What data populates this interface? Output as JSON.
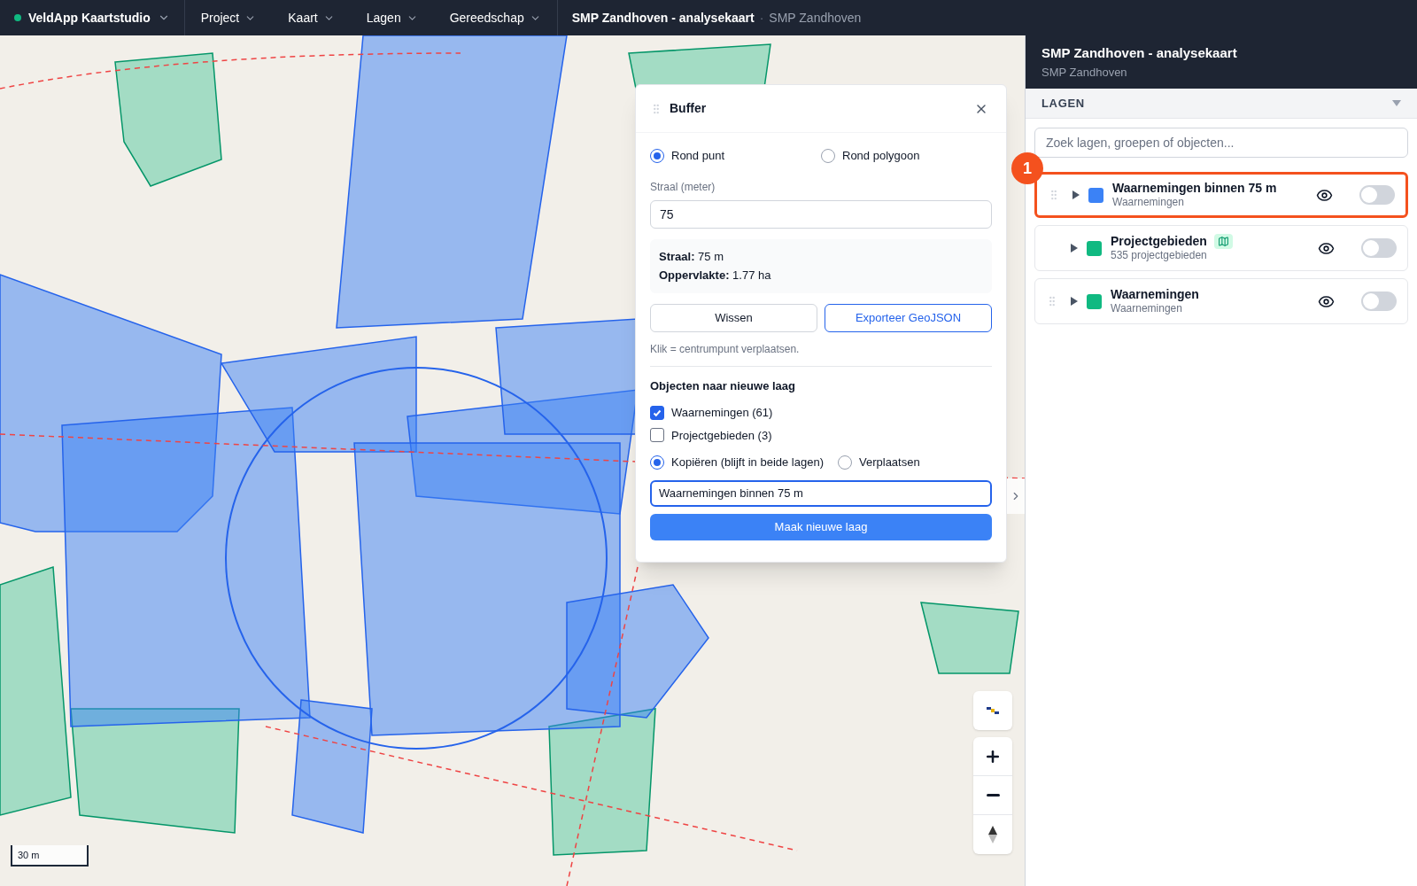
{
  "topbar": {
    "app_name": "VeldApp Kaartstudio",
    "status_online": true,
    "menus": [
      "Project",
      "Kaart",
      "Lagen",
      "Gereedschap"
    ],
    "map_title": "SMP Zandhoven - analysekaart",
    "separator": "·",
    "project": "SMP Zandhoven"
  },
  "buffer_panel": {
    "title": "Buffer",
    "modes": [
      {
        "label": "Rond punt",
        "selected": true
      },
      {
        "label": "Rond polygoon",
        "selected": false
      }
    ],
    "radius_label": "Straal (meter)",
    "radius_value": "75",
    "summary": [
      "**Straal:** 75 m",
      "**Oppervlakte:** 1.77 ha"
    ],
    "buttons": [
      {
        "label": "Wissen",
        "kind": "secondary"
      },
      {
        "label": "Exporteer GeoJSON",
        "kind": "outline"
      }
    ],
    "hint": "Klik = centrumpunt verplaatsen.",
    "section_title": "Objecten naar nieuwe laag",
    "layers": [
      {
        "label": "Waarnemingen (61)",
        "checked": true
      },
      {
        "label": "Projectgebieden (3)",
        "checked": false
      }
    ],
    "actions": [
      {
        "label": "Kopiëren (blijft in beide lagen)",
        "selected": true
      },
      {
        "label": "Verplaatsen",
        "selected": false
      }
    ],
    "new_layer_name": "Waarnemingen binnen 75 m",
    "submit": "Maak nieuwe laag"
  },
  "map": {
    "scale": "30 m"
  },
  "sidebar": {
    "title": "SMP Zandhoven - analysekaart",
    "subtitle": "SMP Zandhoven",
    "section": "LAGEN",
    "expanded": true,
    "search_placeholder": "Zoek lagen, groepen of objecten...",
    "callout": "1",
    "layers": [
      {
        "name": "Waarnemingen binnen 75 m",
        "sub": "Waarnemingen",
        "color": "#3b82f6",
        "draggable": true,
        "badge": false,
        "visible": true,
        "on": false,
        "highlighted": true
      },
      {
        "name": "Projectgebieden",
        "sub": "535 projectgebieden",
        "color": "#10b981",
        "draggable": false,
        "badge": true,
        "visible": true,
        "on": false,
        "highlighted": false
      },
      {
        "name": "Waarnemingen",
        "sub": "Waarnemingen",
        "color": "#10b981",
        "draggable": true,
        "badge": false,
        "visible": true,
        "on": false,
        "highlighted": false
      }
    ]
  }
}
